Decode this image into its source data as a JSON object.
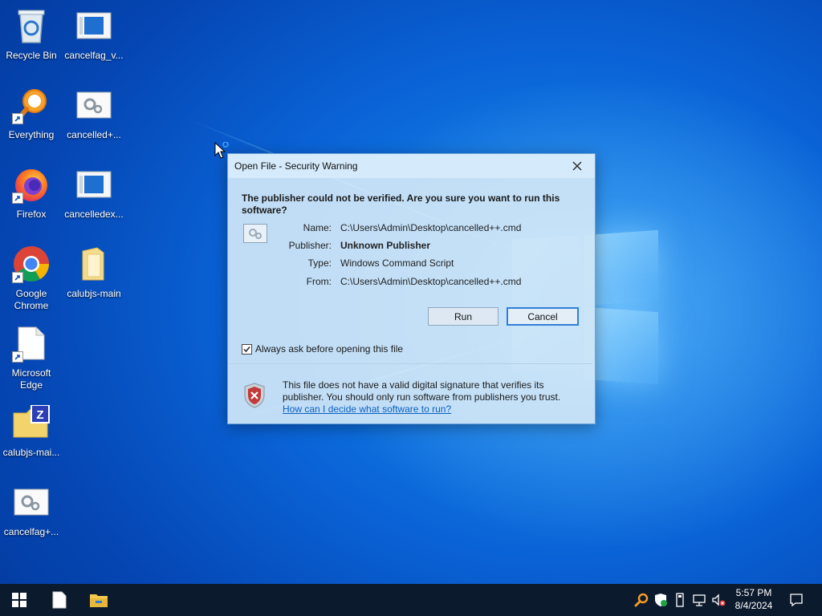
{
  "desktop": {
    "icons": [
      {
        "label": "Recycle Bin"
      },
      {
        "label": "cancelfag_v..."
      },
      {
        "label": "Everything"
      },
      {
        "label": "cancelled+..."
      },
      {
        "label": "Firefox"
      },
      {
        "label": "cancelledex..."
      },
      {
        "label": "Google\nChrome"
      },
      {
        "label": "calubjs-main"
      },
      {
        "label": "Microsoft\nEdge"
      },
      {
        "label": "calubjs-mai..."
      },
      {
        "label": "cancelfag+..."
      }
    ]
  },
  "dialog": {
    "title": "Open File - Security Warning",
    "question": "The publisher could not be verified.  Are you sure you want to run this software?",
    "fields": [
      {
        "key": "Name:",
        "value": "C:\\Users\\Admin\\Desktop\\cancelled++.cmd"
      },
      {
        "key": "Publisher:",
        "value": "Unknown Publisher"
      },
      {
        "key": "Type:",
        "value": "Windows Command Script"
      },
      {
        "key": "From:",
        "value": "C:\\Users\\Admin\\Desktop\\cancelled++.cmd"
      }
    ],
    "run_label": "Run",
    "cancel_label": "Cancel",
    "checkbox_label": "Always ask before opening this file",
    "checkbox_checked": true,
    "warning_text": "This file does not have a valid digital signature that verifies its publisher.  You should only run software from publishers you trust.",
    "warning_link": "How can I decide what software to run?"
  },
  "taskbar": {
    "time": "5:57 PM",
    "date": "8/4/2024",
    "icons": [
      "windows-start-icon",
      "notepad-icon",
      "file-explorer-icon"
    ],
    "tray": [
      "everything-tray-icon",
      "security-tray-icon",
      "usb-tray-icon",
      "network-tray-icon",
      "volume-muted-tray-icon",
      "notification-icon"
    ]
  }
}
